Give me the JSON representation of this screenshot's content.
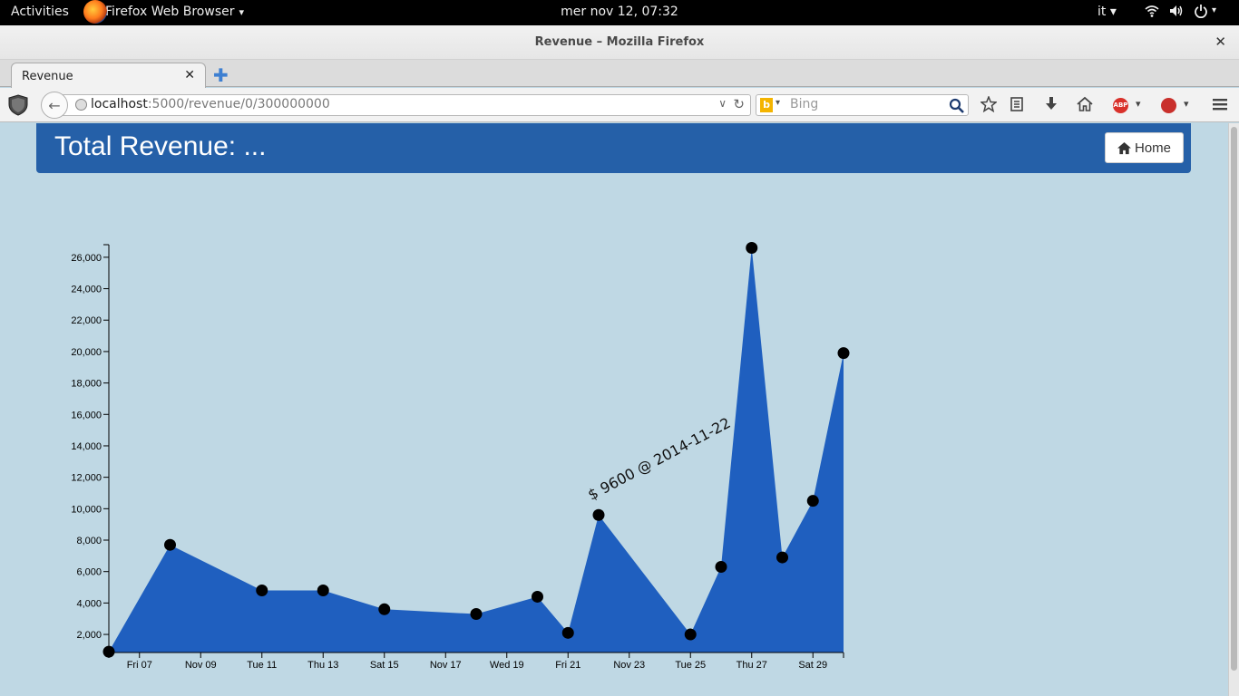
{
  "system": {
    "activities": "Activities",
    "app_name": "Firefox Web Browser",
    "app_caret": "▾",
    "clock": "mer nov 12, 07:32",
    "lang": "it ▾"
  },
  "window": {
    "title": "Revenue – Mozilla Firefox",
    "close": "✕"
  },
  "tabs": [
    {
      "label": "Revenue",
      "close": "✕"
    }
  ],
  "newtab": "✚",
  "toolbar": {
    "back": "←",
    "url_host": "localhost",
    "url_rest": ":5000/revenue/0/300000000",
    "url_drop": "∨",
    "reload": "↻",
    "search_engine_letter": "b",
    "search_engine_drop": "▾",
    "search_placeholder": "Bing",
    "search_icon": "🔍"
  },
  "page": {
    "heading": "Total Revenue: ...",
    "home_label": "Home"
  },
  "colors": {
    "area_fill": "#1f5fbf",
    "point": "#000000",
    "header": "#2560a8",
    "background": "#bfd8e4"
  },
  "chart_data": {
    "type": "area",
    "title": "",
    "xlabel": "",
    "ylabel": "",
    "y_ticks": [
      "2,000",
      "4,000",
      "6,000",
      "8,000",
      "10,000",
      "12,000",
      "14,000",
      "16,000",
      "18,000",
      "20,000",
      "22,000",
      "24,000",
      "26,000"
    ],
    "x_ticks": [
      "Fri 07",
      "Nov 09",
      "Tue 11",
      "Thu 13",
      "Sat 15",
      "Nov 17",
      "Wed 19",
      "Fri 21",
      "Nov 23",
      "Tue 25",
      "Thu 27",
      "Sat 29"
    ],
    "ylim": [
      850,
      26800
    ],
    "xlim": [
      "2014-11-06",
      "2014-11-30"
    ],
    "points": [
      {
        "x": "2014-11-06",
        "y": 900
      },
      {
        "x": "2014-11-08",
        "y": 7700
      },
      {
        "x": "2014-11-11",
        "y": 4800
      },
      {
        "x": "2014-11-13",
        "y": 4800
      },
      {
        "x": "2014-11-15",
        "y": 3600
      },
      {
        "x": "2014-11-18",
        "y": 3300
      },
      {
        "x": "2014-11-20",
        "y": 4400
      },
      {
        "x": "2014-11-21",
        "y": 2100
      },
      {
        "x": "2014-11-22",
        "y": 9600
      },
      {
        "x": "2014-11-25",
        "y": 2000
      },
      {
        "x": "2014-11-26",
        "y": 6300
      },
      {
        "x": "2014-11-27",
        "y": 26600
      },
      {
        "x": "2014-11-28",
        "y": 6900
      },
      {
        "x": "2014-11-29",
        "y": 10500
      },
      {
        "x": "2014-11-30",
        "y": 19900
      }
    ],
    "annotation": "$ 9600 @ 2014-11-22",
    "grid": false,
    "legend": "none"
  }
}
